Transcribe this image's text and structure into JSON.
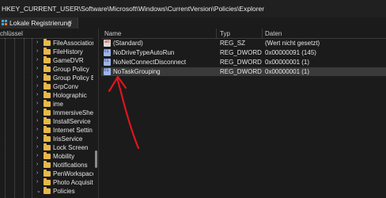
{
  "address": "HKEY_CURRENT_USER\\Software\\Microsoft\\Windows\\CurrentVersion\\Policies\\Explorer",
  "tab": {
    "title": "Lokale Registrierung",
    "close": "×"
  },
  "tree": {
    "header": "chlüssel",
    "items": [
      "FileAssociation",
      "FileHistory",
      "GameDVR",
      "Group Policy",
      "Group Policy E",
      "GrpConv",
      "Holographic",
      "ime",
      "ImmersiveShel",
      "InstallService",
      "Internet Settin",
      "IrisService",
      "Lock Screen",
      "Mobility",
      "Notifications",
      "PenWorkspace",
      "Photo Acquisit",
      "Policies"
    ]
  },
  "list": {
    "columns": {
      "name": "Name",
      "type": "Typ",
      "data": "Daten"
    },
    "rows": [
      {
        "icon": "reg-sz-icon",
        "name": "(Standard)",
        "type": "REG_SZ",
        "data": "(Wert nicht gesetzt)"
      },
      {
        "icon": "reg-dword-icon",
        "name": "NoDriveTypeAutoRun",
        "type": "REG_DWORD",
        "data": "0x00000091 (145)"
      },
      {
        "icon": "reg-dword-icon",
        "name": "NoNetConnectDisconnect",
        "type": "REG_DWORD",
        "data": "0x00000001 (1)"
      },
      {
        "icon": "reg-dword-icon",
        "name": "NoTaskGrouping",
        "type": "REG_DWORD",
        "data": "0x00000001 (1)"
      }
    ],
    "selected_index": 3
  },
  "colors": {
    "annotation": "#e0141e",
    "folder": "#e8b84a",
    "background": "#1b1b1b"
  }
}
